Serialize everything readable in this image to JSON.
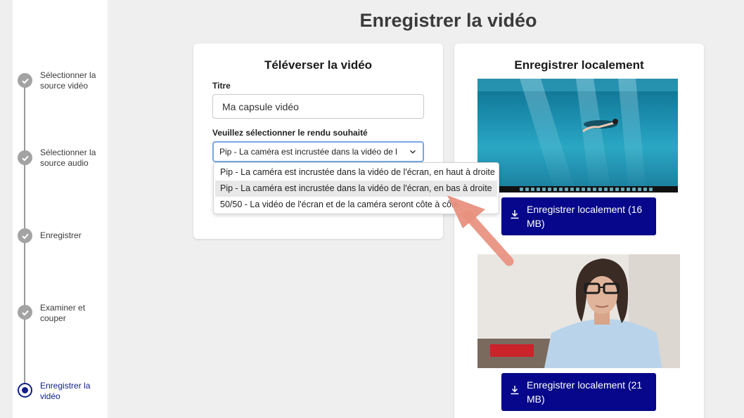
{
  "sidebar": {
    "steps": [
      {
        "label": "Sélectionner la source vidéo",
        "state": "done"
      },
      {
        "label": "Sélectionner la source audio",
        "state": "done"
      },
      {
        "label": "Enregistrer",
        "state": "done"
      },
      {
        "label": "Examiner et couper",
        "state": "done"
      },
      {
        "label": "Enregistrer la vidéo",
        "state": "active"
      }
    ]
  },
  "page": {
    "title": "Enregistrer la vidéo"
  },
  "upload": {
    "heading": "Téléverser la vidéo",
    "title_label": "Titre",
    "title_value": "Ma capsule vidéo",
    "render_label": "Veuillez sélectionner le rendu souhaité",
    "render_selected": "Pip - La caméra est incrustée dans la vidéo de l",
    "options": [
      {
        "label": "Pip - La caméra est incrustée dans la vidéo de l'écran, en haut à droite"
      },
      {
        "label": "Pip - La caméra est incrustée dans la vidéo de l'écran, en bas à droite"
      },
      {
        "label": "50/50 - La vidéo de l'écran et de la caméra seront côte à côte"
      }
    ]
  },
  "local": {
    "heading": "Enregistrer localement",
    "buttons": [
      {
        "label": "Enregistrer localement (16 MB)"
      },
      {
        "label": "Enregistrer localement (21 MB)"
      }
    ]
  },
  "colors": {
    "accent": "#06078a",
    "active_step": "#0f1f86",
    "annotation_arrow": "#e88b7a"
  },
  "icons": [
    "check-icon",
    "chevron-down-icon",
    "download-icon",
    "radio-active-icon"
  ]
}
